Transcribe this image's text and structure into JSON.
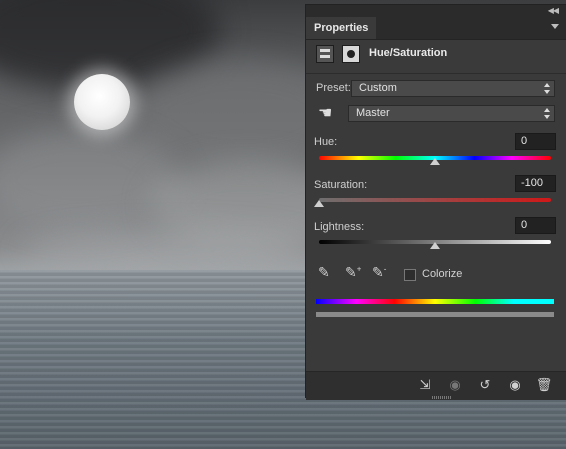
{
  "panel": {
    "tab_label": "Properties",
    "title": "Hue/Saturation",
    "preset_label": "Preset:",
    "preset_value": "Custom",
    "channel_value": "Master",
    "hue": {
      "label": "Hue:",
      "value": "0",
      "position": 0.5
    },
    "saturation": {
      "label": "Saturation:",
      "value": "-100",
      "position": 0.0
    },
    "lightness": {
      "label": "Lightness:",
      "value": "0",
      "position": 0.5
    },
    "colorize_label": "Colorize",
    "colorize_checked": false
  },
  "icons": {
    "collapse": "double-chevron-icon",
    "panel_menu": "panel-menu-icon",
    "adjustment": "adjustment-layer-icon",
    "mask": "layer-mask-icon",
    "targeted_adjust": "hand-adjust-icon",
    "eyedroppers": [
      "eyedropper-icon",
      "eyedropper-plus-icon",
      "eyedropper-minus-icon"
    ],
    "bottom": [
      "clip-to-layer-icon",
      "view-previous-state-icon",
      "reset-icon",
      "visibility-eye-icon",
      "trash-icon"
    ]
  },
  "colors": {
    "panel_bg": "#3a3a3a",
    "hue_gradient": "red-yellow-green-cyan-blue-magenta-red",
    "saturation_gradient": "gray-to-red"
  }
}
